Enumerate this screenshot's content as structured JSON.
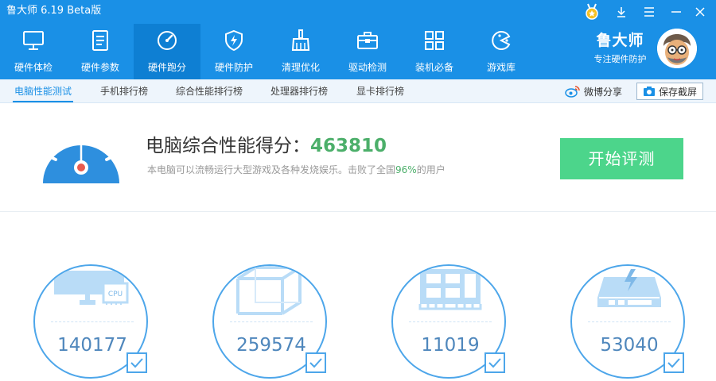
{
  "app": {
    "title": "鲁大师 6.19 Beta版"
  },
  "nav": {
    "items": [
      {
        "label": "硬件体检"
      },
      {
        "label": "硬件参数"
      },
      {
        "label": "硬件跑分"
      },
      {
        "label": "硬件防护"
      },
      {
        "label": "清理优化"
      },
      {
        "label": "驱动检测"
      },
      {
        "label": "装机必备"
      },
      {
        "label": "游戏库"
      }
    ],
    "active_index": 2
  },
  "brand": {
    "name": "鲁大师",
    "slogan": "专注硬件防护"
  },
  "subtabs": [
    {
      "label": "电脑性能测试"
    },
    {
      "label": "手机排行榜"
    },
    {
      "label": "综合性能排行榜"
    },
    {
      "label": "处理器排行榜"
    },
    {
      "label": "显卡排行榜"
    }
  ],
  "toolbar": {
    "share_label": "微博分享",
    "save_label": "保存截屏"
  },
  "score": {
    "title_prefix": "电脑综合性能得分：",
    "value": "463810",
    "desc_prefix": "本电脑可以流畅运行大型游戏及各种发烧娱乐。击败了全国",
    "percent": "96%",
    "desc_suffix": "的用户",
    "button_label": "开始评测"
  },
  "categories": [
    {
      "value": "140177",
      "icon": "monitor-cpu-icon",
      "checked": true
    },
    {
      "value": "259574",
      "icon": "cube-icon",
      "checked": true
    },
    {
      "value": "11019",
      "icon": "memory-module-icon",
      "checked": true
    },
    {
      "value": "53040",
      "icon": "hard-disk-icon",
      "checked": true
    }
  ],
  "colors": {
    "primary_blue": "#1a90e6",
    "active_nav": "#0e7fd3",
    "score_green": "#4caf6a",
    "button_green": "#4cd58b",
    "ring_blue": "#4da6ea"
  },
  "chip_text": "CPU"
}
